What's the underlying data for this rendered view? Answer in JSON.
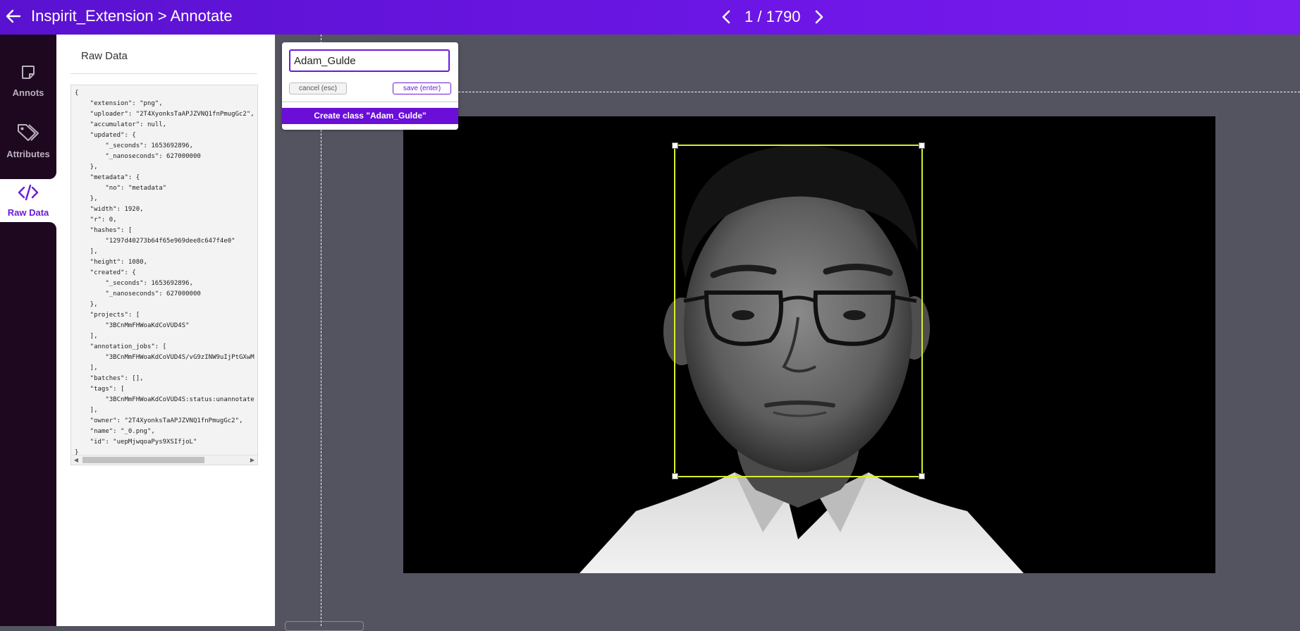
{
  "header": {
    "title": "Inspirit_Extension > Annotate",
    "page_counter": "1 / 1790"
  },
  "nav": {
    "items": [
      {
        "label": "Annots",
        "icon": "note-icon"
      },
      {
        "label": "Attributes",
        "icon": "tags-icon"
      },
      {
        "label": "Raw Data",
        "icon": "code-icon",
        "active": true
      }
    ]
  },
  "raw_panel": {
    "title": "Raw Data",
    "json_lines": [
      "{",
      "    \"extension\": \"png\",",
      "    \"uploader\": \"2T4XyonksTaAPJZVNQ1fnPmugGc2\",",
      "    \"accumulator\": null,",
      "    \"updated\": {",
      "        \"_seconds\": 1653692896,",
      "        \"_nanoseconds\": 627000000",
      "    },",
      "    \"metadata\": {",
      "        \"no\": \"metadata\"",
      "    },",
      "    \"width\": 1920,",
      "    \"r\": 0,",
      "    \"hashes\": [",
      "        \"1297d40273b64f65e969dee8c647f4e0\"",
      "    ],",
      "    \"height\": 1080,",
      "    \"created\": {",
      "        \"_seconds\": 1653692896,",
      "        \"_nanoseconds\": 627000000",
      "    },",
      "    \"projects\": [",
      "        \"3BCnMmFHWoaKdCoVUD4S\"",
      "    ],",
      "    \"annotation_jobs\": [",
      "        \"3BCnMmFHWoaKdCoVUD4S/vG9zINW9uIjPtGXwM",
      "    ],",
      "    \"batches\": [],",
      "    \"tags\": [",
      "        \"3BCnMmFHWoaKdCoVUD4S:status:unannotate",
      "    ],",
      "    \"owner\": \"2T4XyonksTaAPJZVNQ1fnPmugGc2\",",
      "    \"name\": \"_0.png\",",
      "    \"id\": \"uepMjwqoaPys9XSIfjoL\"",
      "}"
    ]
  },
  "class_popup": {
    "input_value": "Adam_Gulde",
    "cancel_label": "cancel (esc)",
    "save_label": "save (enter)",
    "create_label": "Create class \"Adam_Gulde\""
  },
  "colors": {
    "accent": "#6a0ed8",
    "bbox": "#d8ee2a",
    "canvas_bg": "#53545f",
    "nav_dark": "#1e0820"
  }
}
